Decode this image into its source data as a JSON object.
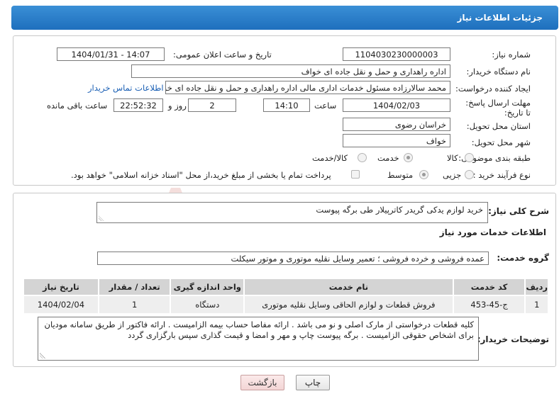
{
  "header": {
    "title": "جزئیات اطلاعات نیاز"
  },
  "form": {
    "need_number_label": "شماره نیاز:",
    "need_number": "1104030230000003",
    "announce_label": "تاریخ و ساعت اعلان عمومی:",
    "announce_value": "1404/01/31 - 14:07",
    "buyer_org_label": "نام دستگاه خریدار:",
    "buyer_org": "اداره راهداری و حمل و نقل جاده ای خواف",
    "requester_label": "ایجاد کننده درخواست:",
    "requester": "محمد سالارزاده مسئول خدمات اداری مالی  اداره راهداری و حمل و نقل جاده ای خواف",
    "contact_link": "اطلاعات تماس خریدار",
    "deadline_label": "مهلت ارسال پاسخ: تا تاریخ:",
    "deadline_date": "1404/02/03",
    "time_label": "ساعت",
    "deadline_time": "14:10",
    "days_value": "2",
    "days_label": "روز و",
    "remaining_time": "22:52:32",
    "remaining_label": "ساعت باقی مانده",
    "province_label": "استان محل تحویل:",
    "province": "خراسان رضوی",
    "city_label": "شهر محل تحویل:",
    "city": "خواف",
    "category_label": "طبقه بندی موضوعی:",
    "category_options": [
      "کالا",
      "خدمت",
      "کالا/خدمت"
    ],
    "category_selected": "خدمت",
    "process_label": "نوع فرآیند خرید :",
    "process_options": [
      "جزیی",
      "متوسط"
    ],
    "process_selected": "متوسط",
    "payment_note": "پرداخت تمام یا بخشی از مبلغ خرید،از محل \"اسناد خزانه اسلامی\" خواهد بود."
  },
  "need": {
    "summary_label": "شرح کلی نیاز:",
    "summary": "خرید لوازم یدکی گریدر کاترپیلار طی برگه پیوست",
    "services_title": "اطلاعات خدمات مورد نیاز",
    "group_label": "گروه خدمت:",
    "group_value": "عمده فروشی و خرده فروشی ؛ تعمیر وسایل نقلیه موتوری و موتور سیکلت"
  },
  "table": {
    "headers": [
      "ردیف",
      "کد خدمت",
      "نام خدمت",
      "واحد اندازه گیری",
      "تعداد / مقدار",
      "تاریخ نیاز"
    ],
    "rows": [
      [
        "1",
        "ج-45-453",
        "فروش قطعات و لوازم الحاقی وسایل نقلیه موتوری",
        "دستگاه",
        "1",
        "1404/02/04"
      ]
    ]
  },
  "notes": {
    "label": "توضیحات خریدار:",
    "text": "کلیه قطعات درخواستی از مارک اصلی و نو می باشد . ارائه مفاصا حساب بیمه الزامیست . ارائه فاکتور از طریق سامانه مودیان برای اشخاص حقوقی الزامیست . برگه پیوست چاپ و مهر و امضا و قیمت گذاری سپس بارگزاری گردد"
  },
  "buttons": {
    "print": "چاپ",
    "back": "بازگشت"
  },
  "watermark": {
    "text": "AriaTender.neT"
  },
  "colors": {
    "header": "#1e6fbd",
    "link": "#1a5fb4",
    "watermark": "#c0392b"
  }
}
